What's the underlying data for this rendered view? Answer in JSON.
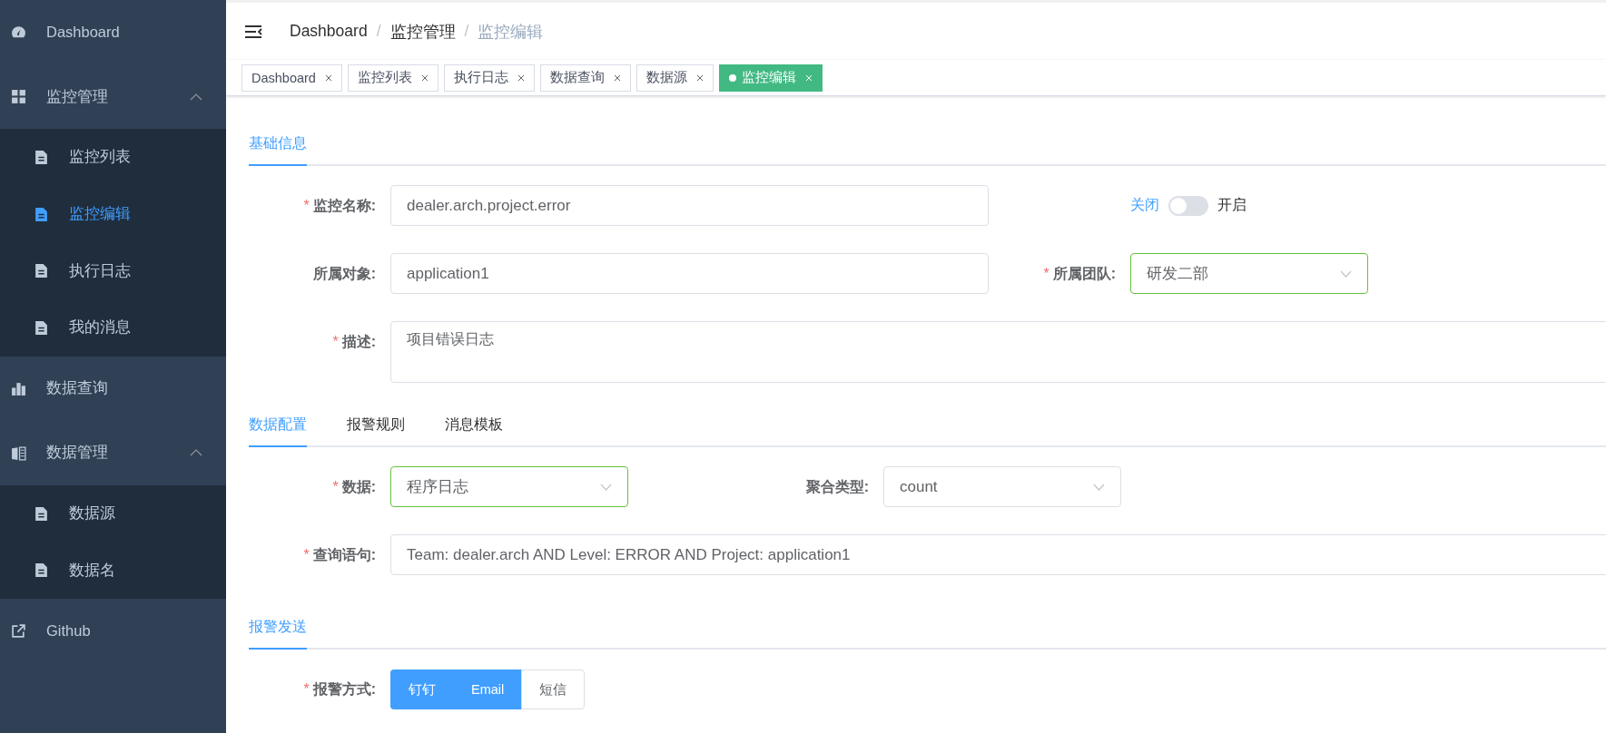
{
  "sidebar": {
    "items": [
      {
        "label": "Dashboard",
        "selected": false
      },
      {
        "label": "监控管理",
        "selected": false,
        "expanded": true,
        "children": [
          {
            "label": "监控列表",
            "selected": false
          },
          {
            "label": "监控编辑",
            "selected": true
          },
          {
            "label": "执行日志",
            "selected": false
          },
          {
            "label": "我的消息",
            "selected": false
          }
        ]
      },
      {
        "label": "数据查询",
        "selected": false
      },
      {
        "label": "数据管理",
        "selected": false,
        "expanded": true,
        "children": [
          {
            "label": "数据源",
            "selected": false
          },
          {
            "label": "数据名",
            "selected": false
          }
        ]
      },
      {
        "label": "Github",
        "selected": false
      }
    ]
  },
  "navbar": {
    "breadcrumb": {
      "separator": "/",
      "items": [
        {
          "label": "Dashboard",
          "current": false
        },
        {
          "label": "监控管理",
          "current": false
        },
        {
          "label": "监控编辑",
          "current": true
        }
      ]
    }
  },
  "tags": [
    {
      "label": "Dashboard",
      "selected": false
    },
    {
      "label": "监控列表",
      "selected": false
    },
    {
      "label": "执行日志",
      "selected": false
    },
    {
      "label": "数据查询",
      "selected": false
    },
    {
      "label": "数据源",
      "selected": false
    },
    {
      "label": "监控编辑",
      "selected": true
    }
  ],
  "form": {
    "sections": [
      {
        "tabs": [
          {
            "label": "基础信息",
            "selected": true
          }
        ],
        "rows": [
          [
            {
              "kind": "input",
              "required_mark": "*",
              "label": "监控名称:",
              "value": "dealer.arch.project.error",
              "valid": false
            },
            {
              "kind": "switch",
              "off_label": "关闭",
              "on_label": "开启",
              "on": false
            }
          ],
          [
            {
              "kind": "input",
              "label": "所属对象:",
              "value": "application1",
              "valid": false
            },
            {
              "kind": "select",
              "required_mark": "*",
              "label": "所属团队:",
              "value": "研发二部",
              "valid": true
            }
          ],
          [
            {
              "kind": "textarea",
              "required_mark": "*",
              "label": "描述:",
              "value": "项目错误日志",
              "valid": false
            }
          ]
        ]
      },
      {
        "tabs": [
          {
            "label": "数据配置",
            "selected": true
          },
          {
            "label": "报警规则",
            "selected": false
          },
          {
            "label": "消息模板",
            "selected": false
          }
        ],
        "rows": [
          [
            {
              "kind": "select",
              "required_mark": "*",
              "label": "数据:",
              "value": "程序日志",
              "valid": true
            },
            {
              "kind": "select",
              "label": "聚合类型:",
              "value": "count",
              "valid": false
            }
          ],
          [
            {
              "kind": "wide",
              "required_mark": "*",
              "label": "查询语句:",
              "value": "Team: dealer.arch AND Level: ERROR AND Project: application1",
              "valid": false
            }
          ]
        ]
      },
      {
        "tabs": [
          {
            "label": "报警发送",
            "selected": true
          }
        ],
        "rows": [
          [
            {
              "kind": "buttons",
              "required_mark": "*",
              "label": "报警方式:",
              "options": [
                {
                  "label": "钉钉",
                  "selected": true
                },
                {
                  "label": "Email",
                  "selected": true
                },
                {
                  "label": "短信",
                  "selected": false
                }
              ]
            }
          ]
        ]
      }
    ]
  }
}
